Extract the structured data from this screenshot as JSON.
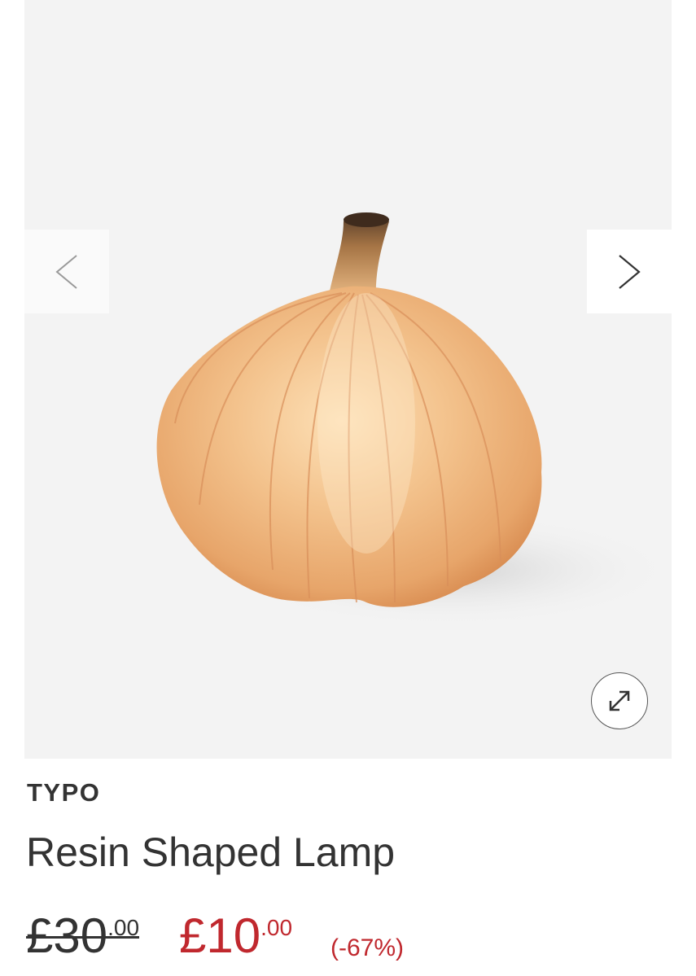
{
  "gallery": {
    "image_subject": "garlic-shaped resin lamp",
    "prev_icon": "chevron-left-icon",
    "next_icon": "chevron-right-icon",
    "expand_icon": "expand-arrows-icon",
    "background_color": "#f3f3f3"
  },
  "product": {
    "brand": "TYPO",
    "title": "Resin Shaped Lamp"
  },
  "price": {
    "old_main": "£30",
    "old_cents": ".00",
    "new_main": "£10",
    "new_cents": ".00",
    "discount": "(-67%)",
    "sale_color": "#c0282e"
  }
}
